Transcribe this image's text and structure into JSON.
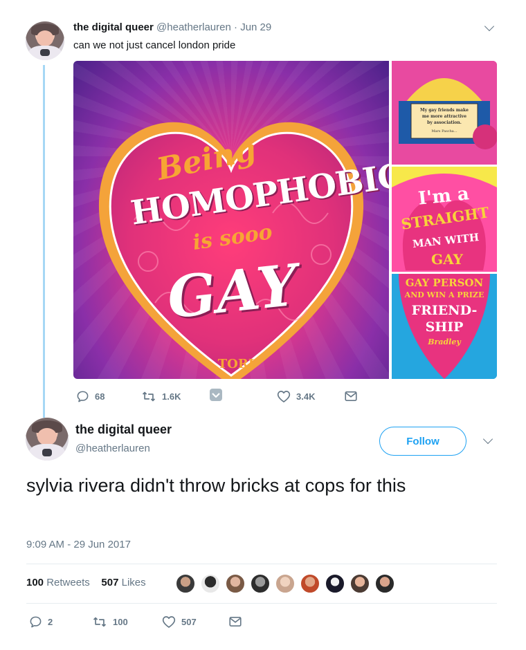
{
  "parent_tweet": {
    "author_name": "the digital queer",
    "author_handle": "@heatherlauren",
    "separator": "·",
    "date": "Jun 29",
    "text": "can we not just cancel london pride",
    "media": {
      "main_book": {
        "title_line1": "Being",
        "title_line2": "HOMOPHOBIC",
        "title_line3": "is sooo",
        "title_line4": "GAY",
        "author": "TORI"
      },
      "side_book_1": {
        "quote_line1": "My gay friends make",
        "quote_line2": "me more attractive",
        "quote_line3": "by association.",
        "quote_author": "Mars Pascha..."
      },
      "side_book_2": {
        "line1": "I'm a",
        "line2": "STRAIGHT",
        "line3": "MAN WITH",
        "line4": "GAY"
      },
      "side_book_3": {
        "line1": "GAY PERSON",
        "line2": "AND WIN A PRIZE",
        "line3": "FRIEND-",
        "line4": "SHIP",
        "author": "Bradley"
      }
    },
    "actions": {
      "replies": "68",
      "retweets": "1.6K",
      "likes": "3.4K"
    }
  },
  "main_tweet": {
    "author_name": "the digital queer",
    "author_handle": "@heatherlauren",
    "follow_label": "Follow",
    "text": "sylvia rivera didn't throw bricks at cops for this",
    "timestamp": "9:09 AM - 29 Jun 2017",
    "stats": {
      "retweets_count": "100",
      "retweets_label": "Retweets",
      "likes_count": "507",
      "likes_label": "Likes"
    },
    "actions": {
      "replies": "2",
      "retweets": "100",
      "likes": "507"
    }
  },
  "colors": {
    "twitter_blue": "#1da1f2",
    "thread_line": "#a6d7f5",
    "muted_text": "#657786",
    "primary_text": "#14171a",
    "divider": "#e6ecf0"
  },
  "icons": [
    "reply-icon",
    "retweet-icon",
    "heart-icon",
    "mail-icon",
    "chevron-down-icon",
    "dm-vote-icon"
  ]
}
